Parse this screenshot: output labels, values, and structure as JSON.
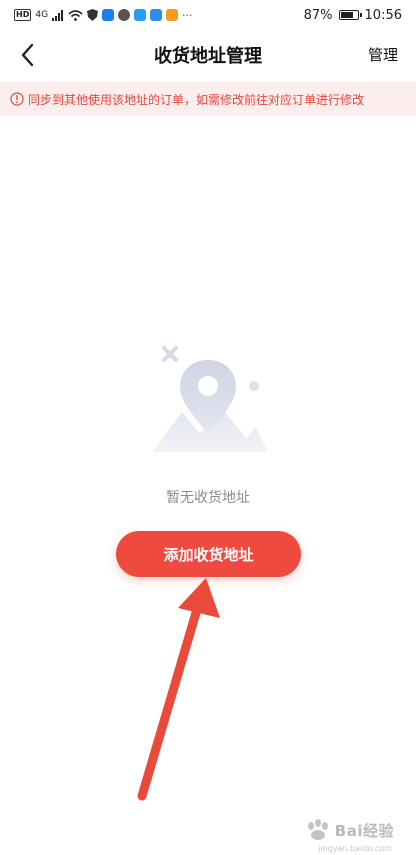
{
  "status_bar": {
    "network": "HD",
    "signal": "4G",
    "more": "···",
    "battery_percent": "87%",
    "battery_level": 0.87,
    "time": "10:56"
  },
  "nav": {
    "title": "收货地址管理",
    "manage_label": "管理"
  },
  "notice": {
    "text": "同步到其他使用该地址的订单，如需修改前往对应订单进行修改"
  },
  "empty_state": {
    "text": "暂无收货地址",
    "add_button_label": "添加收货地址"
  },
  "watermark": {
    "brand": "Bai经验",
    "domain": "jingyan.baidu.com"
  },
  "colors": {
    "accent": "#ef4a40",
    "notice_bg": "#fdeeee",
    "notice_text": "#e2473f",
    "arrow": "#ea4a3b"
  },
  "icons": {
    "back": "chevron-left-icon",
    "notice": "info-circle-icon",
    "empty": "location-pin-illustration"
  }
}
